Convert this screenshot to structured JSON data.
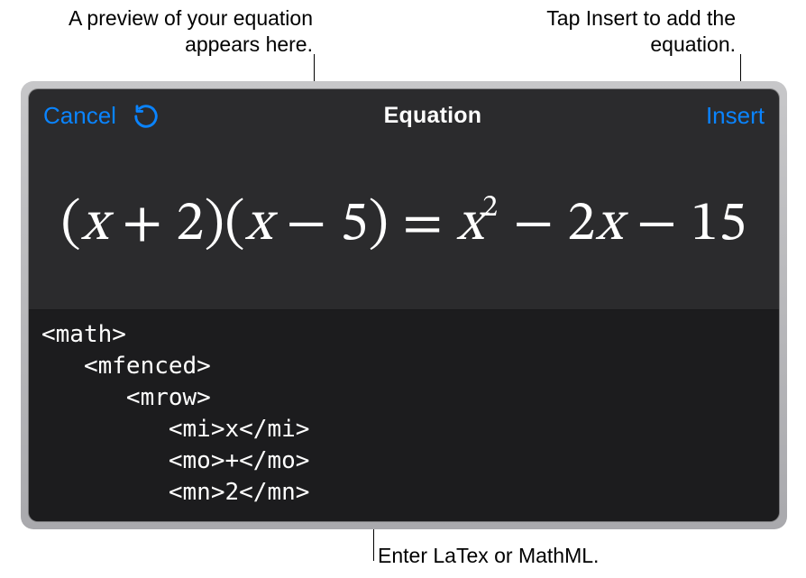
{
  "callouts": {
    "preview": "A preview of your\nequation appears here.",
    "insert": "Tap Insert to add\nthe equation.",
    "code": "Enter LaTex or MathML."
  },
  "header": {
    "cancel_label": "Cancel",
    "title": "Equation",
    "insert_label": "Insert"
  },
  "equation_preview": "(x + 2)(x − 5) = x² − 2x − 15",
  "code_text": "<math>\n   <mfenced>\n      <mrow>\n         <mi>x</mi>\n         <mo>+</mo>\n         <mn>2</mn>"
}
